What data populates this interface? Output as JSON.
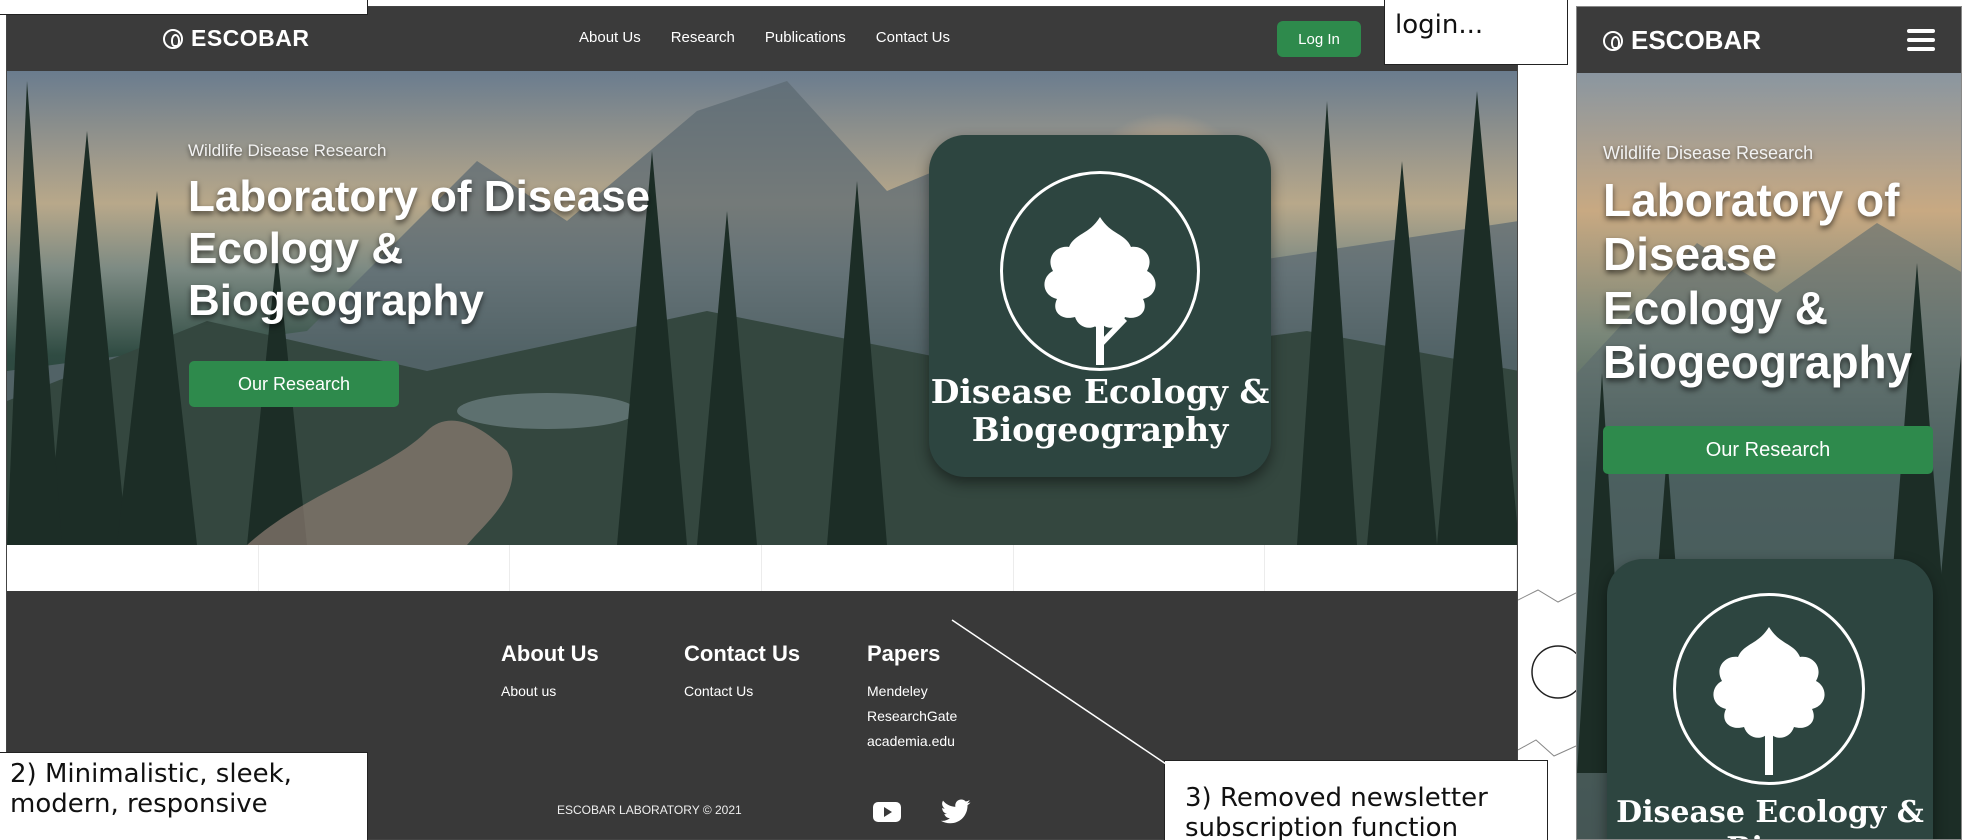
{
  "desktop": {
    "brand": "ESCOBAR",
    "nav": [
      "About Us",
      "Research",
      "Publications",
      "Contact Us"
    ],
    "login_label": "Log In",
    "hero": {
      "eyebrow": "Wildlife Disease Research",
      "title": "Laboratory of Disease Ecology & Biogeography",
      "button": "Our Research",
      "badge_text": "Disease Ecology & Biogeography"
    },
    "footer": {
      "columns": [
        {
          "heading": "About Us",
          "links": [
            "About us"
          ]
        },
        {
          "heading": "Contact Us",
          "links": [
            "Contact Us"
          ]
        },
        {
          "heading": "Papers",
          "links": [
            "Mendeley",
            "ResearchGate",
            "academia.edu"
          ]
        }
      ],
      "copyright": "ESCOBAR LABORATORY © 2021",
      "social_icons": [
        "youtube-icon",
        "twitter-icon"
      ]
    }
  },
  "mobile": {
    "brand": "ESCOBAR",
    "menu_icon": "hamburger-icon",
    "hero": {
      "eyebrow": "Wildlife Disease Research",
      "title": "Laboratory of Disease Ecology & Biogeography",
      "button": "Our Research",
      "badge_text": "Disease Ecology & Bio..."
    }
  },
  "annotations": {
    "note1": "login...",
    "note2": "2) Minimalistic, sleek, modern, responsive",
    "note3": "3) Removed newsletter subscription function"
  },
  "colors": {
    "nav_bg": "#3b3b3b",
    "accent_green": "#2e8a4c",
    "badge_bg": "#2d4540",
    "footer_bg": "#393939"
  }
}
